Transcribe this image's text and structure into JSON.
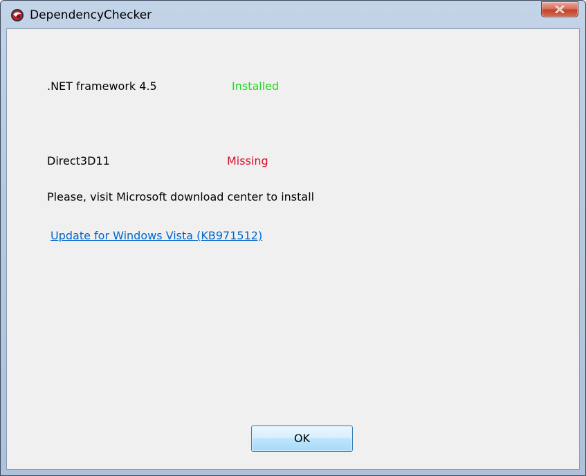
{
  "window": {
    "title": "DependencyChecker",
    "app_icon": "dependency-checker-app-icon",
    "close_icon": "close-icon"
  },
  "dependencies": [
    {
      "name": ".NET framework 4.5",
      "status": "Installed",
      "status_color": "#1ed81e"
    },
    {
      "name": "Direct3D11",
      "status": "Missing",
      "status_color": "#d8102a"
    }
  ],
  "message": "Please, visit Microsoft download center to install",
  "download_link": {
    "text": "Update for Windows Vista (KB971512)",
    "color": "#0066cc"
  },
  "ok_button": {
    "label": "OK"
  }
}
